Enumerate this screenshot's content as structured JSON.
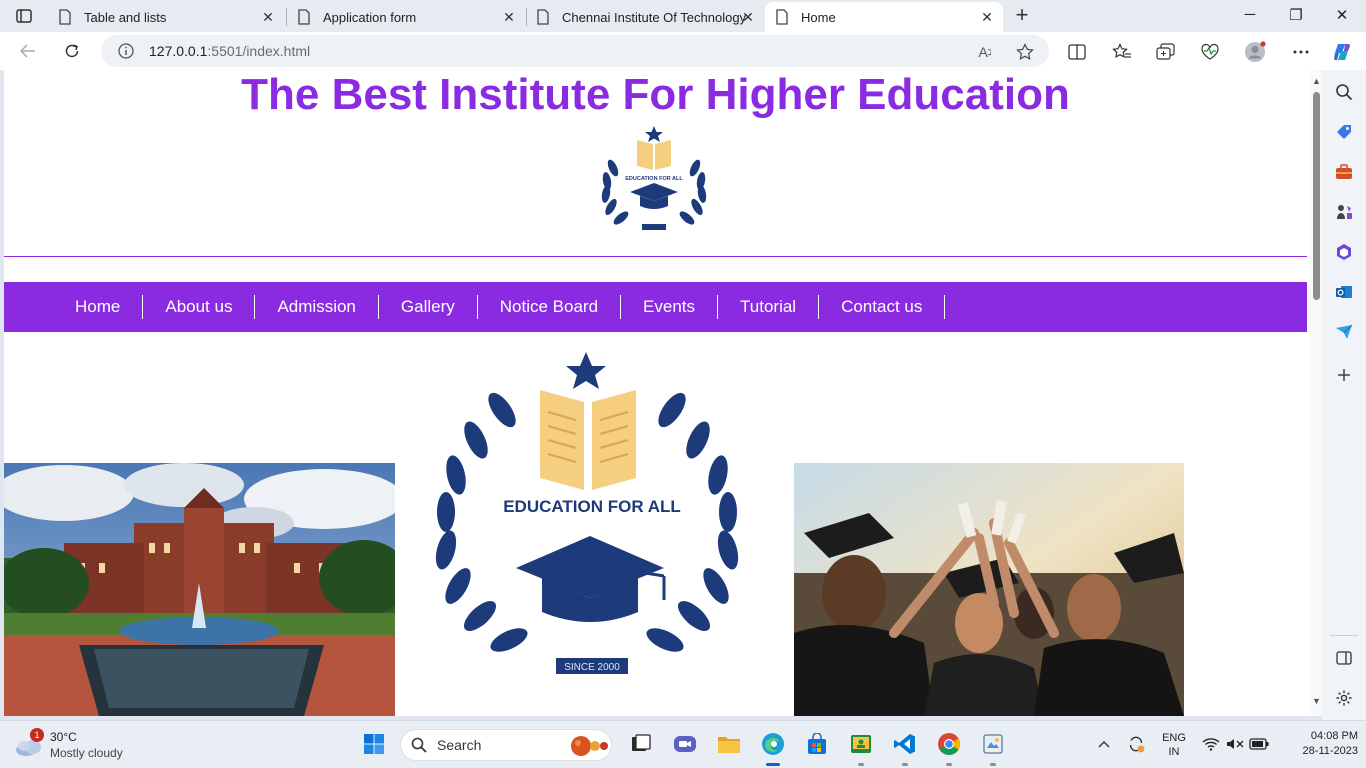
{
  "browser": {
    "tabs": [
      {
        "title": "Table and lists",
        "active": false
      },
      {
        "title": "Application form",
        "active": false
      },
      {
        "title": "Chennai Institute Of Technology",
        "active": false
      },
      {
        "title": "Home",
        "active": true
      }
    ],
    "url_host": "127.0.0.1",
    "url_path": ":5501/index.html",
    "colors": {
      "tabbar": "#e6ebf2",
      "urlbox": "#eef1f5"
    }
  },
  "page": {
    "title": "The Best Institute For Higher Education",
    "logo_text": "EDUCATION FOR ALL",
    "logo_since": "SINCE 2000",
    "nav": [
      {
        "label": "Home"
      },
      {
        "label": "About us"
      },
      {
        "label": "Admission"
      },
      {
        "label": "Gallery"
      },
      {
        "label": "Notice Board"
      },
      {
        "label": "Events"
      },
      {
        "label": "Tutorial"
      },
      {
        "label": "Contact us"
      }
    ],
    "colors": {
      "accent": "#8a2be2",
      "logo_navy": "#1d3a7a",
      "logo_gold": "#f5cf7f"
    }
  },
  "taskbar": {
    "weather_temp": "30°C",
    "weather_cond": "Mostly cloudy",
    "weather_badge": "1",
    "search_label": "Search",
    "lang_top": "ENG",
    "lang_bottom": "IN",
    "time": "04:08 PM",
    "date": "28-11-2023"
  }
}
